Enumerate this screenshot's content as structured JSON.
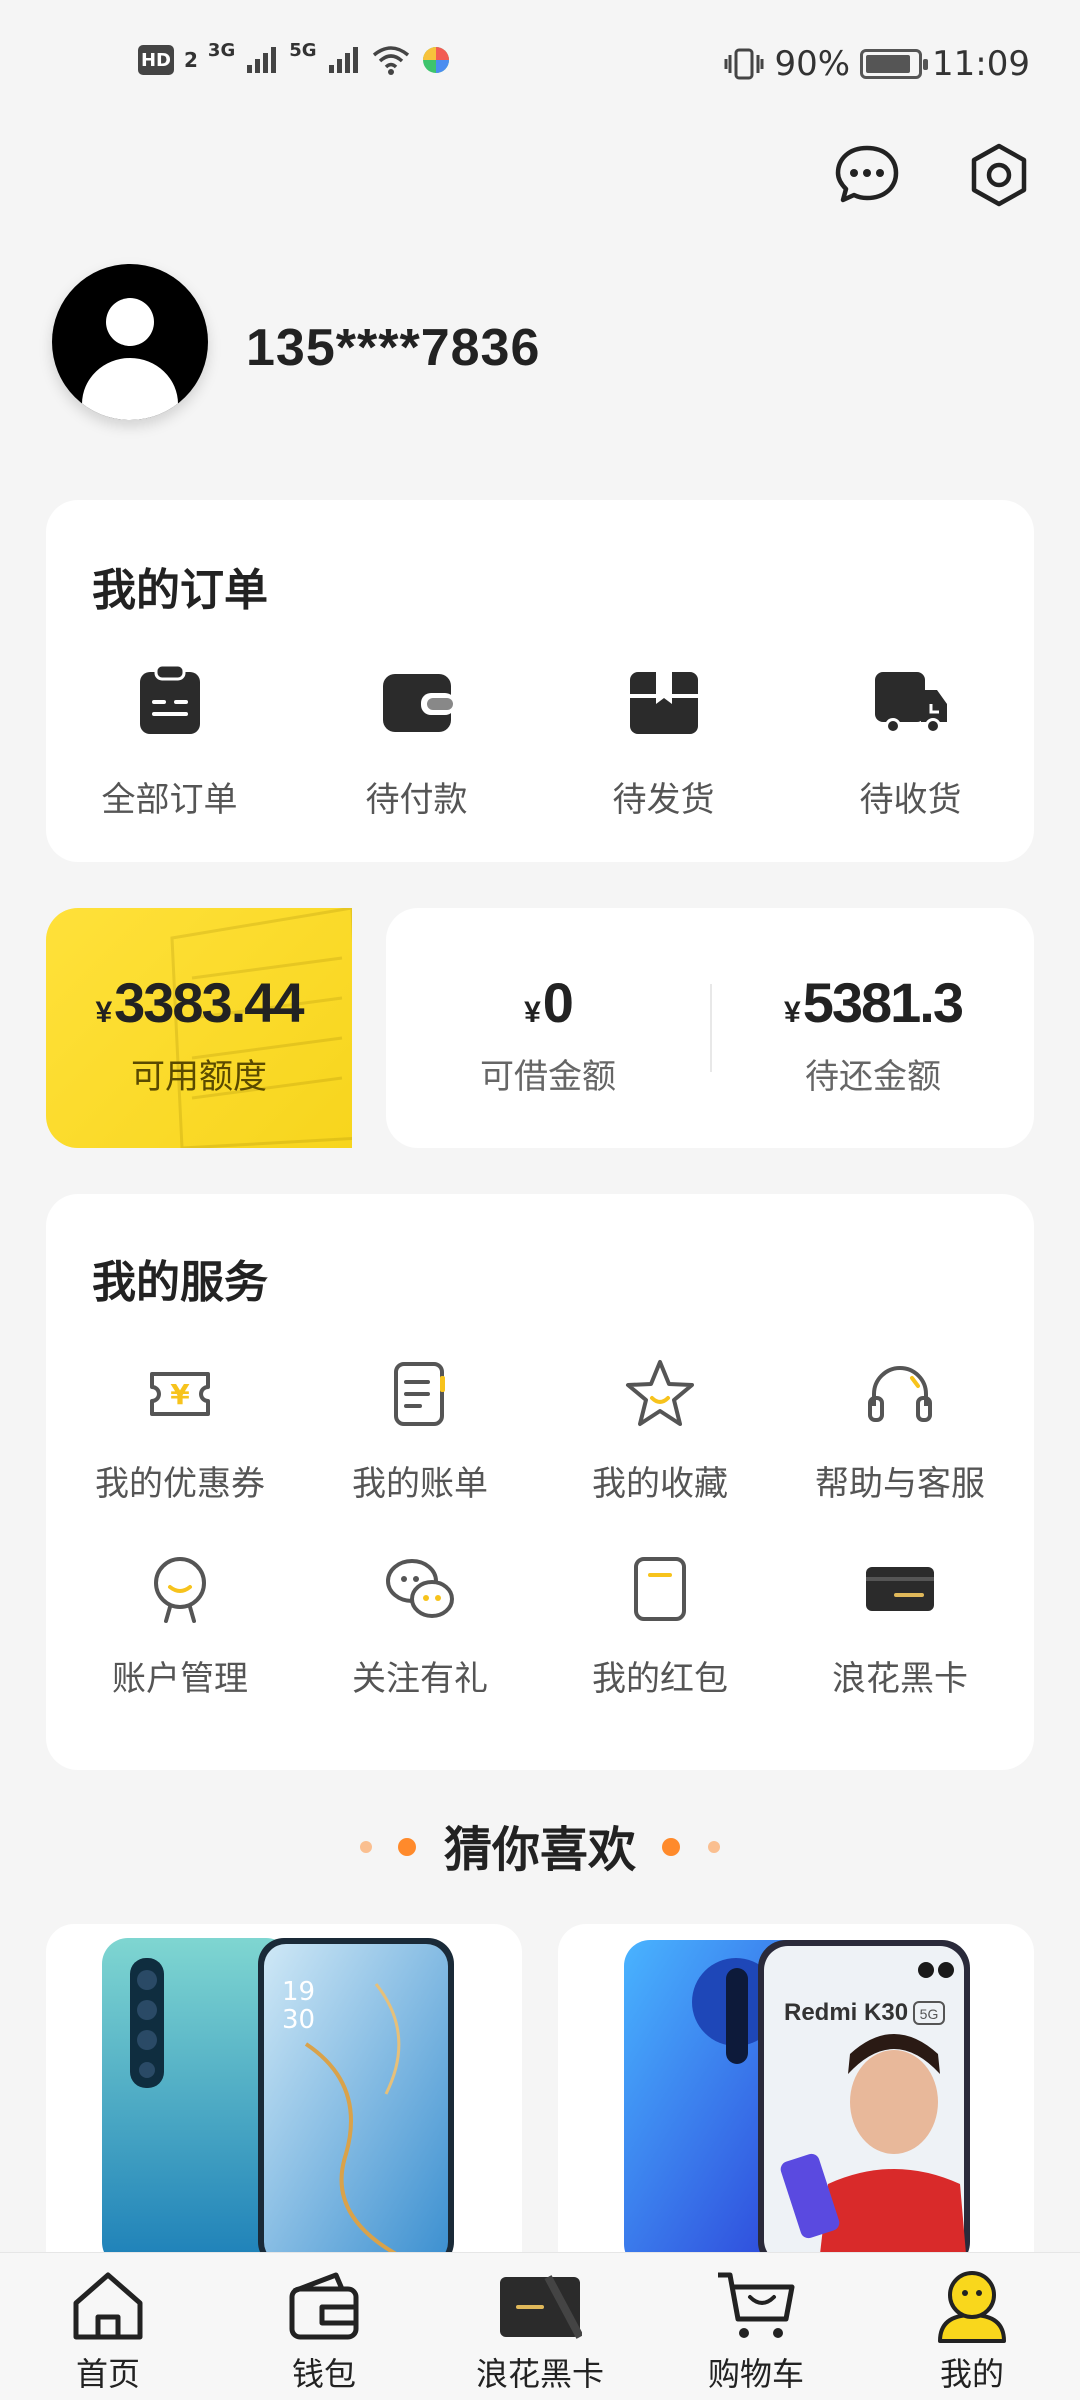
{
  "status_bar": {
    "hd": "HD",
    "sim": "2",
    "net1": "3G",
    "net2": "5G",
    "battery_pct": "90%",
    "battery_level": 0.9,
    "time": "11:09"
  },
  "profile": {
    "phone": "135****7836"
  },
  "orders": {
    "title": "我的订单",
    "items": [
      {
        "label": "全部订单",
        "icon": "clipboard-icon"
      },
      {
        "label": "待付款",
        "icon": "wallet-icon"
      },
      {
        "label": "待发货",
        "icon": "box-icon"
      },
      {
        "label": "待收货",
        "icon": "truck-icon"
      }
    ]
  },
  "credit": {
    "yen": "¥",
    "available": {
      "value": "3383.44",
      "label": "可用额度"
    },
    "borrowable": {
      "value": "0",
      "label": "可借金额"
    },
    "to_repay": {
      "value": "5381.3",
      "label": "待还金额"
    }
  },
  "services": {
    "title": "我的服务",
    "items": [
      {
        "label": "我的优惠券",
        "icon": "coupon-icon"
      },
      {
        "label": "我的账单",
        "icon": "bill-icon"
      },
      {
        "label": "我的收藏",
        "icon": "star-icon"
      },
      {
        "label": "帮助与客服",
        "icon": "headset-icon"
      },
      {
        "label": "账户管理",
        "icon": "account-icon"
      },
      {
        "label": "关注有礼",
        "icon": "wechat-icon"
      },
      {
        "label": "我的红包",
        "icon": "red-packet-icon"
      },
      {
        "label": "浪花黑卡",
        "icon": "black-card-icon"
      }
    ]
  },
  "recommend": {
    "title": "猜你喜欢",
    "products": [
      {
        "screen_text": "19\n30"
      },
      {
        "brand_text": "Redmi K30",
        "badge": "5G"
      }
    ]
  },
  "nav": {
    "items": [
      {
        "label": "首页",
        "icon": "home-icon"
      },
      {
        "label": "钱包",
        "icon": "wallet-icon"
      },
      {
        "label": "浪花黑卡",
        "icon": "black-card-icon"
      },
      {
        "label": "购物车",
        "icon": "cart-icon"
      },
      {
        "label": "我的",
        "icon": "profile-icon"
      }
    ]
  },
  "colors": {
    "accent_yellow": "#f9d71c",
    "dot_orange": "#ff8a2b",
    "icon_dark": "#2b2b2b"
  }
}
